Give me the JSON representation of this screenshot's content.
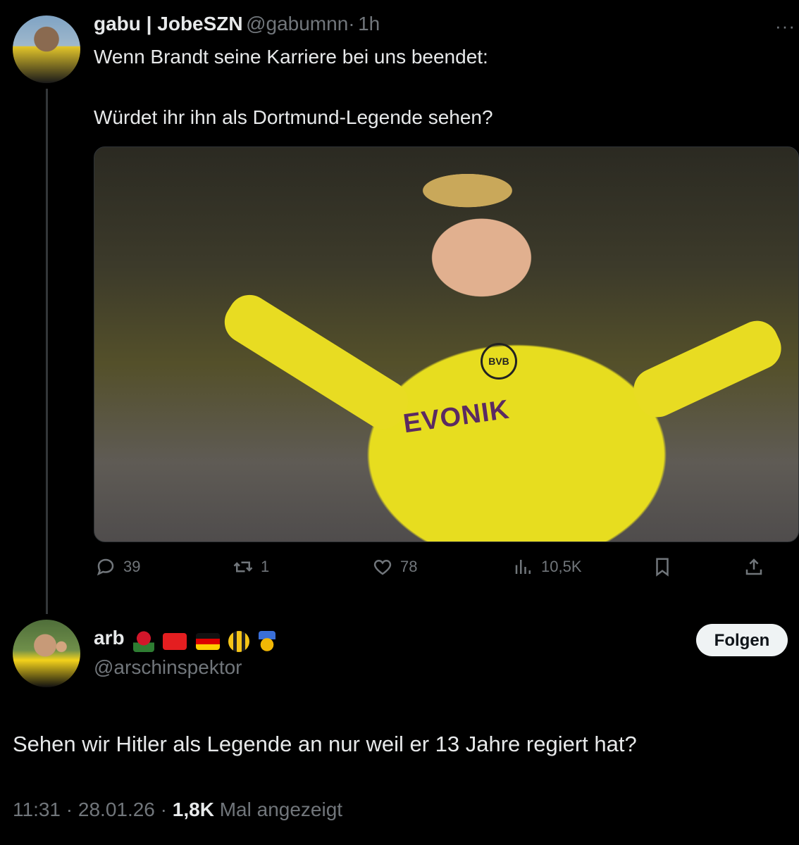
{
  "tweet": {
    "author_name": "gabu | JobeSZN",
    "author_handle": "@gabumnn",
    "separator": "·",
    "time": "1h",
    "more_label": "···",
    "text_line1": "Wenn Brandt seine Karriere bei uns beendet:",
    "text_line2": "Würdet ihr ihn als Dortmund-Legende sehen?",
    "media_text": {
      "sponsor": "EVONIK",
      "badge": "BVB"
    },
    "actions": {
      "replies": "39",
      "reposts": "1",
      "likes": "78",
      "views": "10,5K"
    }
  },
  "reply": {
    "author_name": "arb",
    "emoji_names": [
      "rose",
      "albania-flag",
      "germany-flag",
      "bee",
      "gold-medal"
    ],
    "author_handle": "@arschinspektor",
    "follow_label": "Folgen",
    "text": "Sehen wir Hitler als Legende an nur weil er 13 Jahre regiert hat?",
    "meta": {
      "time": "11:31",
      "separator": "·",
      "date": "28.01.26",
      "views": "1,8K",
      "views_label": "Mal angezeigt"
    }
  }
}
